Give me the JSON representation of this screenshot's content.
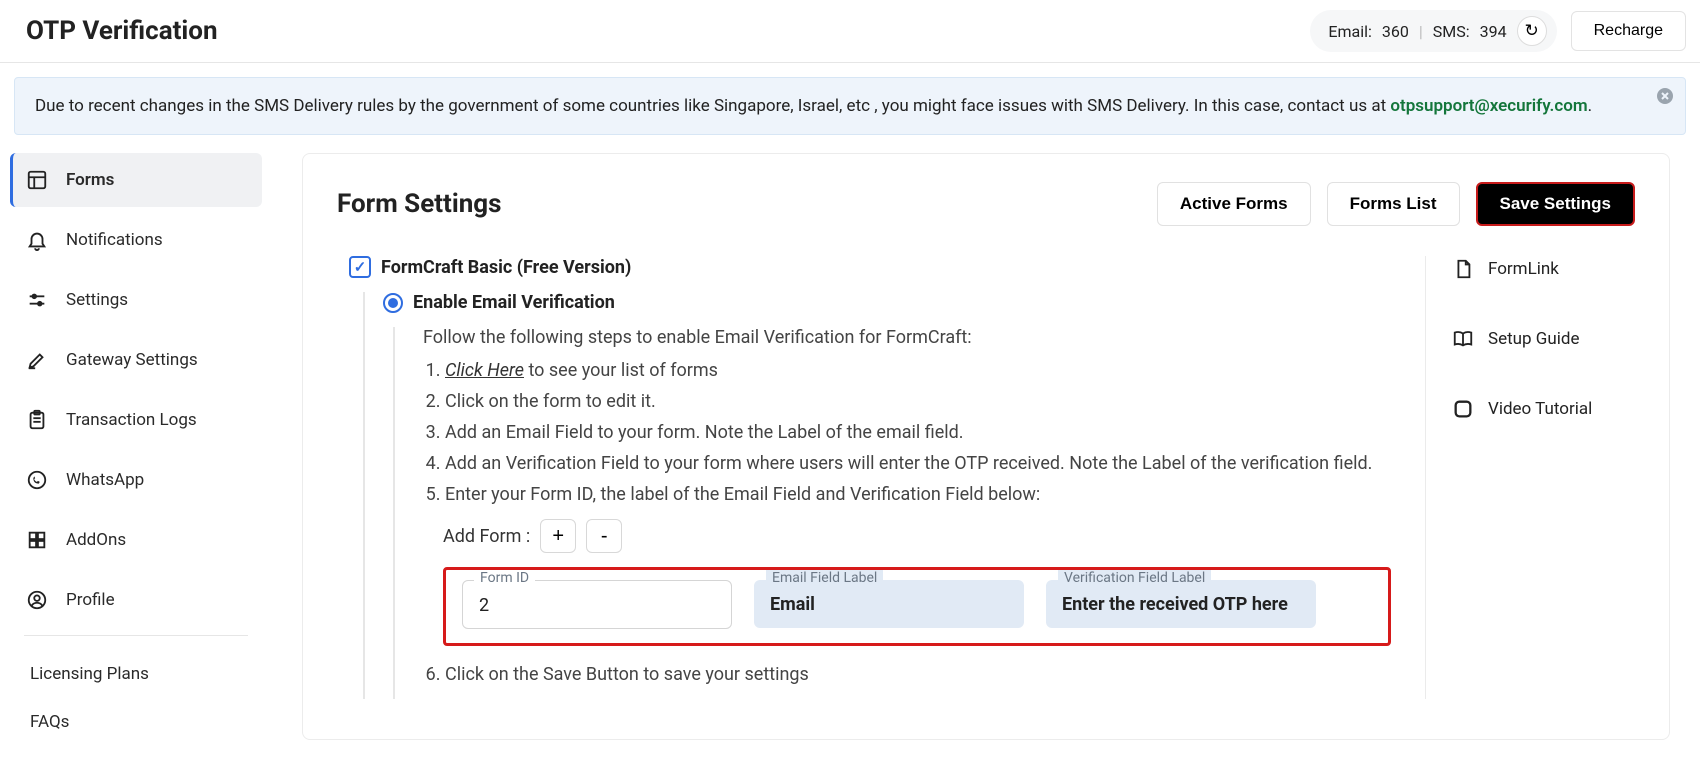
{
  "header": {
    "title": "OTP Verification",
    "quota_email_label": "Email:",
    "quota_email_value": "360",
    "quota_sms_label": "SMS:",
    "quota_sms_value": "394",
    "recharge": "Recharge"
  },
  "notice": {
    "text_a": "Due to recent changes in the SMS Delivery rules by the government of some countries like Singapore, Israel, etc , you might face issues with SMS Delivery. In this case, contact us at ",
    "contact": "otpsupport@xecurify.com",
    "text_b": "."
  },
  "sidebar": {
    "items": [
      "Forms",
      "Notifications",
      "Settings",
      "Gateway Settings",
      "Transaction Logs",
      "WhatsApp",
      "AddOns",
      "Profile"
    ],
    "bottom": [
      "Licensing Plans",
      "FAQs"
    ]
  },
  "main": {
    "title": "Form Settings",
    "actions": {
      "active_forms": "Active Forms",
      "forms_list": "Forms List",
      "save": "Save Settings"
    },
    "right_links": {
      "formlink": "FormLink",
      "setup_guide": "Setup Guide",
      "video_tutorial": "Video Tutorial"
    },
    "form": {
      "checkbox_label": "FormCraft Basic (Free Version)",
      "radio_label": "Enable Email Verification",
      "intro": "Follow the following steps to enable Email Verification for FormCraft:",
      "steps": {
        "s1_link": "Click Here",
        "s1_rest": " to see your list of forms",
        "s2": "Click on the form to edit it.",
        "s3": "Add an Email Field to your form. Note the Label of the email field.",
        "s4": "Add an Verification Field to your form where users will enter the OTP received. Note the Label of the verification field.",
        "s5": "Enter your Form ID, the label of the Email Field and Verification Field below:",
        "s6": "Click on the Save Button to save your settings"
      },
      "add_form_label": "Add Form :",
      "plus": "+",
      "minus": "-",
      "fields": {
        "form_id_label": "Form ID",
        "form_id_value": "2",
        "email_label": "Email Field Label",
        "email_value": "Email",
        "verif_label": "Verification Field Label",
        "verif_value": "Enter the received OTP here"
      }
    }
  }
}
